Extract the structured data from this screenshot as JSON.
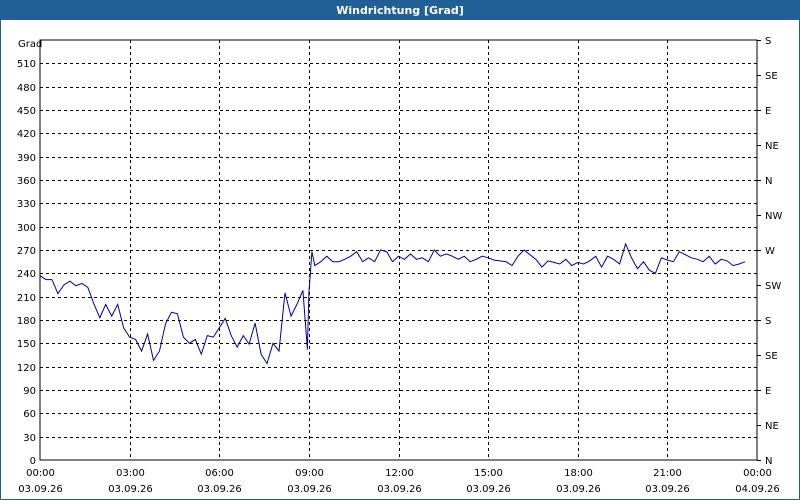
{
  "window": {
    "title": "Windrichtung [Grad]"
  },
  "colors": {
    "title_bar": "#215f97",
    "series": "#000099",
    "grid": "#000000"
  },
  "chart_data": {
    "type": "line",
    "title": "Windrichtung [Grad]",
    "ylabel": "Grad",
    "ylim": [
      0,
      540
    ],
    "xlim": [
      "03.09.26 00:00",
      "04.09.26 00:00"
    ],
    "grid": true,
    "y_ticks": [
      0,
      30,
      60,
      90,
      120,
      150,
      180,
      210,
      240,
      270,
      300,
      330,
      360,
      390,
      420,
      450,
      480,
      510
    ],
    "x_ticks": [
      {
        "time": "00:00",
        "date": "03.09.26"
      },
      {
        "time": "03:00",
        "date": "03.09.26"
      },
      {
        "time": "06:00",
        "date": "03.09.26"
      },
      {
        "time": "09:00",
        "date": "03.09.26"
      },
      {
        "time": "12:00",
        "date": "03.09.26"
      },
      {
        "time": "15:00",
        "date": "03.09.26"
      },
      {
        "time": "18:00",
        "date": "03.09.26"
      },
      {
        "time": "21:00",
        "date": "03.09.26"
      },
      {
        "time": "00:00",
        "date": "04.09.26"
      }
    ],
    "right_axis_labels": [
      "N",
      "NE",
      "E",
      "SE",
      "S",
      "SW",
      "W",
      "NW",
      "N",
      "NE",
      "E",
      "SE",
      "S"
    ],
    "series": [
      {
        "x_hours": [
          0,
          0.2,
          0.4,
          0.6,
          0.8,
          1,
          1.2,
          1.4,
          1.6,
          1.8,
          2,
          2.2,
          2.4,
          2.6,
          2.8,
          3,
          3.2,
          3.4,
          3.6,
          3.8,
          4,
          4.2,
          4.4,
          4.6,
          4.8,
          5,
          5.2,
          5.4,
          5.6,
          5.8,
          6,
          6.2,
          6.4,
          6.6,
          6.8,
          7,
          7.2,
          7.4,
          7.6,
          7.8,
          8,
          8.2,
          8.4,
          8.6,
          8.8,
          8.95,
          9.0,
          9.1,
          9.2,
          9.4,
          9.6,
          9.8,
          10,
          10.2,
          10.4,
          10.6,
          10.8,
          11,
          11.2,
          11.4,
          11.6,
          11.8,
          12,
          12.2,
          12.4,
          12.6,
          12.8,
          13,
          13.2,
          13.4,
          13.6,
          13.8,
          14,
          14.2,
          14.4,
          14.6,
          14.8,
          15,
          15.2,
          15.4,
          15.6,
          15.8,
          16,
          16.2,
          16.4,
          16.6,
          16.8,
          17,
          17.2,
          17.4,
          17.6,
          17.8,
          18,
          18.2,
          18.4,
          18.6,
          18.8,
          19,
          19.2,
          19.4,
          19.6,
          19.8,
          20,
          20.2,
          20.4,
          20.6,
          20.8,
          21,
          21.2,
          21.4,
          21.6,
          21.8,
          22,
          22.2,
          22.4,
          22.6,
          22.8,
          23,
          23.2,
          23.4,
          23.6,
          23.8
        ],
        "values": [
          237,
          232,
          232,
          214,
          225,
          230,
          224,
          227,
          222,
          201,
          183,
          200,
          185,
          200,
          170,
          158,
          155,
          140,
          162,
          128,
          140,
          175,
          190,
          188,
          158,
          150,
          155,
          136,
          160,
          158,
          170,
          182,
          160,
          145,
          160,
          149,
          176,
          136,
          124,
          150,
          140,
          215,
          185,
          200,
          218,
          142,
          215,
          268,
          250,
          255,
          262,
          255,
          255,
          258,
          262,
          268,
          255,
          260,
          255,
          270,
          268,
          255,
          262,
          258,
          265,
          258,
          260,
          255,
          270,
          262,
          265,
          262,
          258,
          262,
          255,
          258,
          262,
          260,
          257,
          256,
          255,
          250,
          262,
          270,
          264,
          258,
          248,
          256,
          254,
          252,
          258,
          250,
          254,
          252,
          256,
          262,
          248,
          262,
          258,
          252,
          278,
          260,
          246,
          255,
          244,
          240,
          260,
          257,
          255,
          268,
          264,
          260,
          258,
          255,
          262,
          252,
          258,
          256,
          250,
          252,
          255
        ]
      }
    ]
  }
}
